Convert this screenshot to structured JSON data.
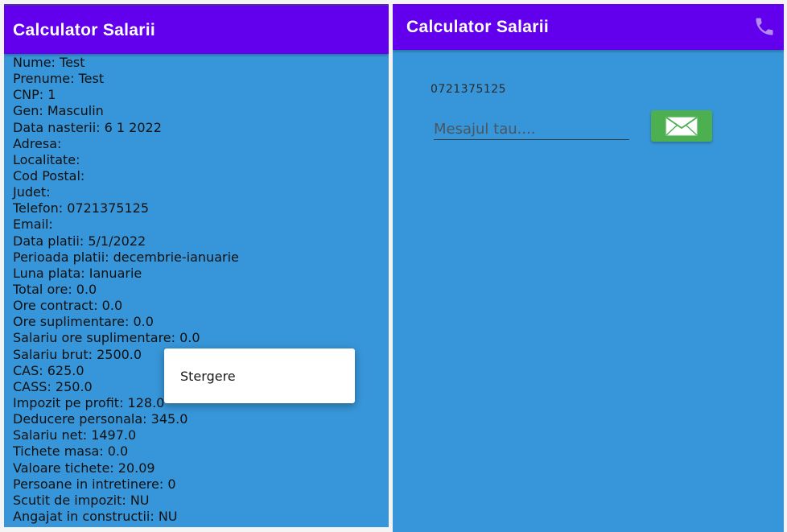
{
  "colors": {
    "app_bar": "#6200ee",
    "screen_background": "#3796d9",
    "send_button": "#4caf50",
    "phone_icon": "#b48cf0"
  },
  "left_screen": {
    "app_bar": {
      "title": "Calculator Salarii"
    },
    "details": [
      "Nume: Test",
      "Prenume: Test",
      "CNP: 1",
      "Gen: Masculin",
      "Data nasterii: 6 1 2022",
      "Adresa:",
      "Localitate:",
      "Cod Postal:",
      "Judet:",
      "Telefon: 0721375125",
      "Email:",
      "Data platii: 5/1/2022",
      "Perioada platii: decembrie-ianuarie",
      "Luna plata: Ianuarie",
      "Total ore: 0.0",
      "Ore contract: 0.0",
      "Ore suplimentare: 0.0",
      "Salariu ore suplimentare: 0.0",
      "Salariu brut: 2500.0",
      "CAS: 625.0",
      "CASS: 250.0",
      "Impozit pe profit: 128.0",
      "Deducere personala: 345.0",
      "Salariu net: 1497.0",
      "Tichete masa: 0.0",
      "Valoare tichete: 20.09",
      "Persoane in intretinere: 0",
      "Scutit de impozit: NU",
      "Angajat in constructii: NU"
    ],
    "context_menu": {
      "items": [
        "Stergere"
      ]
    }
  },
  "right_screen": {
    "app_bar": {
      "title": "Calculator Salarii",
      "action_icon": "phone-icon"
    },
    "phone_number": "0721375125",
    "message_input": {
      "value": "",
      "placeholder": "Mesajul tau...."
    },
    "send_button": {
      "icon": "envelope-icon"
    }
  }
}
